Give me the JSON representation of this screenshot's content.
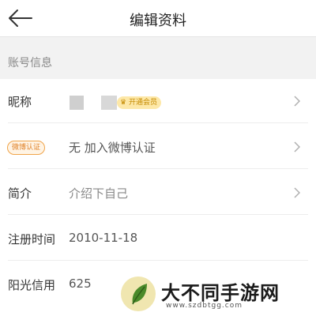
{
  "header": {
    "title": "编辑资料",
    "back_icon": "arrow-left-icon"
  },
  "section": {
    "label": "账号信息"
  },
  "rows": {
    "nickname": {
      "label": "昵称",
      "vip_badge": "开通会员"
    },
    "weibo": {
      "badge": "微博认证",
      "value": "无 加入微博认证"
    },
    "intro": {
      "label": "简介",
      "value": "介绍下自己"
    },
    "register": {
      "label": "注册时间",
      "value": "2010-11-18"
    },
    "credit": {
      "label": "阳光信用",
      "value": "625"
    }
  },
  "watermark": {
    "text": "大不同手游网",
    "url": "www.szdbtgg.com"
  },
  "colors": {
    "accent_orange": "#e0832a",
    "vip_gold": "#c58a00"
  }
}
